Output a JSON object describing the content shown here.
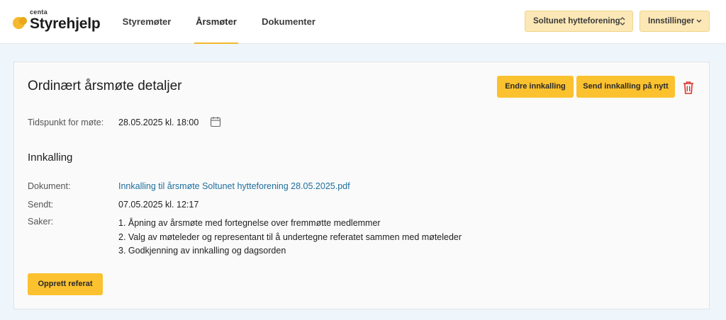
{
  "logo": {
    "small": "centa",
    "main": "Styrehjelp"
  },
  "nav": {
    "items": [
      "Styremøter",
      "Årsmøter",
      "Dokumenter"
    ],
    "active": "Årsmøter"
  },
  "header": {
    "association_select": "Soltunet hytteforening",
    "settings_menu": "Innstillinger"
  },
  "card": {
    "title": "Ordinært årsmøte detaljer",
    "edit_button": "Endre innkalling",
    "resend_button": "Send innkalling på nytt",
    "meeting_time_label": "Tidspunkt for møte:",
    "meeting_time_value": "28.05.2025 kl. 18:00",
    "section_title": "Innkalling",
    "document_label": "Dokument:",
    "document_link": "Innkalling til årsmøte Soltunet hytteforening 28.05.2025.pdf",
    "sent_label": "Sendt:",
    "sent_value": "07.05.2025 kl. 12:17",
    "items_label": "Saker:",
    "items": [
      "1. Åpning av årsmøte med fortegnelse over fremmøtte medlemmer",
      "2. Valg av møteleder og representant til å undertegne referatet sammen med møteleder",
      "3. Godkjenning av innkalling og dagsorden"
    ],
    "create_minutes_button": "Opprett referat"
  },
  "colors": {
    "accent": "#fbc12f",
    "link": "#1e6f9e",
    "delete": "#d9342b"
  }
}
